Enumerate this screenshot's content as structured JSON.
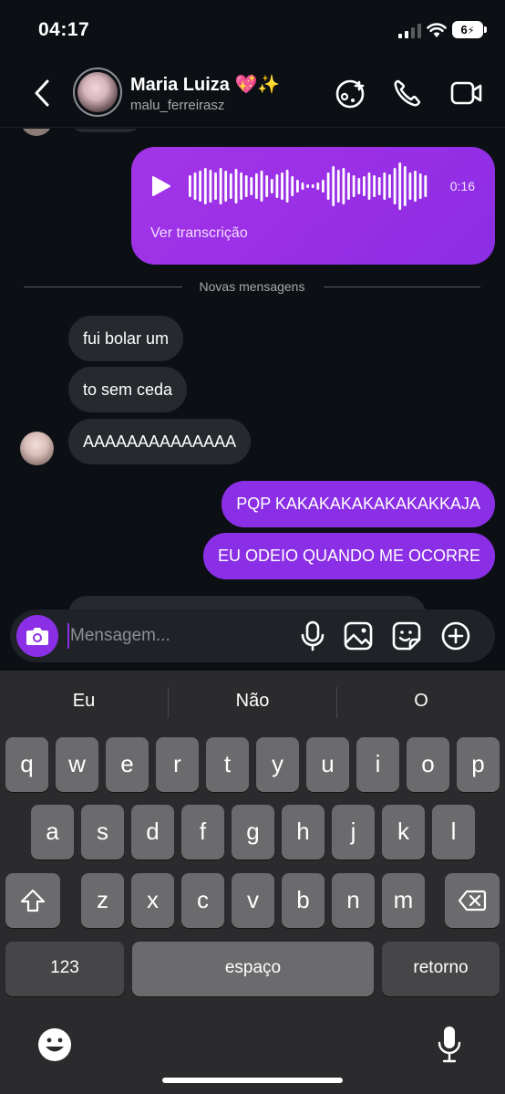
{
  "status": {
    "time": "04:17",
    "battery": "6"
  },
  "header": {
    "name": "Maria Luiza 💖✨",
    "username": "malu_ferreirasz"
  },
  "voice_message": {
    "duration": "0:16",
    "transcript_link": "Ver transcrição"
  },
  "divider": "Novas mensagens",
  "incoming": [
    "fui bolar um",
    "to sem ceda",
    "AAAAAAAAAAAAAA"
  ],
  "outgoing": [
    "PQP KAKAKAKAKAKAKAKKAJA",
    "EU ODEIO QUANDO ME OCORRE"
  ],
  "composer": {
    "placeholder": "Mensagem..."
  },
  "keyboard": {
    "suggestions": [
      "Eu",
      "Não",
      "O"
    ],
    "row1": [
      "q",
      "w",
      "e",
      "r",
      "t",
      "y",
      "u",
      "i",
      "o",
      "p"
    ],
    "row2": [
      "a",
      "s",
      "d",
      "f",
      "g",
      "h",
      "j",
      "k",
      "l"
    ],
    "row3": [
      "z",
      "x",
      "c",
      "v",
      "b",
      "n",
      "m"
    ],
    "numbers_key": "123",
    "space_key": "espaço",
    "return_key": "retorno"
  },
  "colors": {
    "accent": "#8b2fe6",
    "incoming_bubble": "#262a2f",
    "background": "#0c1014",
    "keyboard": "#2b2b2d"
  }
}
